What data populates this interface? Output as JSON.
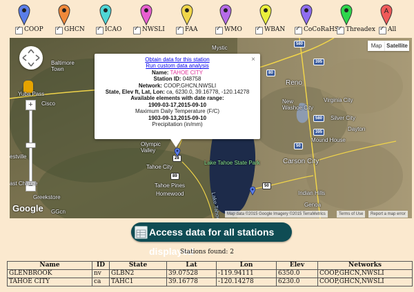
{
  "networks": [
    {
      "label": "COOP",
      "pin_color": "#5b7ee8",
      "checked": true
    },
    {
      "label": "GHCN",
      "pin_color": "#f0893a",
      "checked": true
    },
    {
      "label": "ICAO",
      "pin_color": "#4fd6d6",
      "checked": true
    },
    {
      "label": "NWSLI",
      "pin_color": "#e85fd0",
      "checked": true
    },
    {
      "label": "FAA",
      "pin_color": "#f0d64a",
      "checked": true
    },
    {
      "label": "WMO",
      "pin_color": "#b66be8",
      "checked": true
    },
    {
      "label": "WBAN",
      "pin_color": "#eaf03c",
      "checked": true
    },
    {
      "label": "CoCoRaHS",
      "pin_color": "#8f6df0",
      "checked": true
    },
    {
      "label": "Threadex",
      "pin_color": "#2fd64c",
      "checked": true
    },
    {
      "label": "All",
      "pin_color": "#f05a5a",
      "pin_letter": "A",
      "checked": true
    }
  ],
  "map": {
    "map_type_map": "Map",
    "map_type_satellite": "Satellite",
    "attribution": "Map data ©2015 Google Imagery ©2015 TerraMetrics",
    "terms": "Terms of Use",
    "report": "Report a map error",
    "logo": "Google",
    "labels": {
      "mystic": "Mystic",
      "baltimore_town": "Baltimore\nTown",
      "reno": "Reno",
      "yuba_pass": "Yuba Pass",
      "cisco": "Cisco",
      "virginia_city": "Virginia City",
      "new_washoe_city": "New\nWashoe City",
      "silver_city": "Silver City",
      "dayton": "Dayton",
      "olympic_valley": "Olympic\nValley",
      "mound_house": "Mound House",
      "tahoe_city": "Tahoe City",
      "lake_tahoe_state_park": "Lake Tahoe State Park",
      "carson_city": "Carson City",
      "westville": "estville",
      "east_chance": "ast Chance",
      "tahoe_pines": "Tahoe Pines",
      "homewood": "Homewood",
      "indian_hills": "Indian Hills",
      "lake_tahoe": "Lake Tahoe",
      "greekstore": "Greekstore",
      "genoa": "Genoa",
      "ggcn": "GGcn"
    },
    "highways": [
      "580",
      "395",
      "80",
      "580",
      "395",
      "50",
      "50",
      "89",
      "28"
    ]
  },
  "info_window": {
    "obtain_link": "Obtain data for this station",
    "custom_link": "Run custom data analysis",
    "name_label": "Name:",
    "name_value": "TAHOE CITY",
    "id_label": "Station ID:",
    "id_value": "048758",
    "network_label": "Network:",
    "network_value": "COOP,GHCN,NWSLI",
    "loc_label": "State, Elev ft, Lat, Lon:",
    "loc_value": "ca, 6230.0, 39.16778, -120.14278",
    "elements_label": "Available elements with date range:",
    "el1_range": "1909-03-17,2015-09-10",
    "el1_name": "Maximum Daily Temperature (F/C)",
    "el2_range": "1903-09-13,2015-09-10",
    "el2_name": "Precipitation (in/mm)",
    "close": "×"
  },
  "access_button": "Access data for all stations displayed",
  "stations_found": "Stations found: 2",
  "table": {
    "headers": [
      "Name",
      "ID",
      "State",
      "Lat",
      "Lon",
      "Elev",
      "Networks"
    ],
    "rows": [
      [
        "GLENBROOK",
        "nv",
        "GLBN2",
        "39.07528",
        "-119.94111",
        "6350.0",
        "COOP,GHCN,NWSLI"
      ],
      [
        "TAHOE CITY",
        "ca",
        "TAHC1",
        "39.16778",
        "-120.14278",
        "6230.0",
        "COOP,GHCN,NWSLI"
      ]
    ]
  }
}
